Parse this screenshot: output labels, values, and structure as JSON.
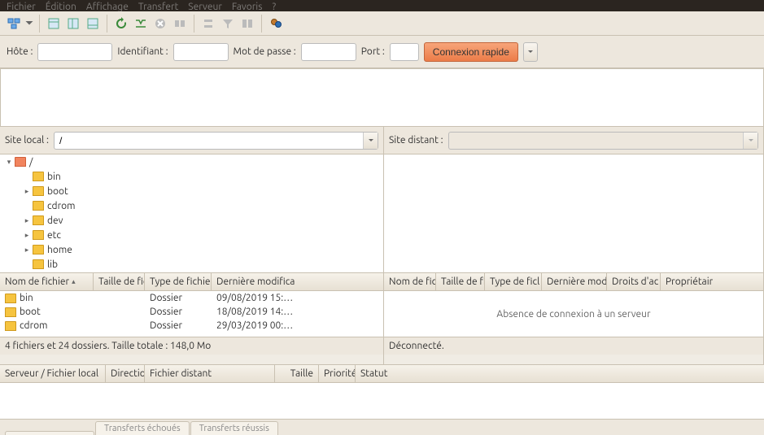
{
  "menubar": [
    "Fichier",
    "Édition",
    "Affichage",
    "Transfert",
    "Serveur",
    "Favoris",
    "?"
  ],
  "quick": {
    "host_label": "Hôte :",
    "user_label": "Identifiant :",
    "pass_label": "Mot de passe :",
    "port_label": "Port :",
    "connect_label": "Connexion rapide"
  },
  "local": {
    "site_label": "Site local :",
    "site_value": "/",
    "tree": [
      {
        "name": "/",
        "depth": 0,
        "expander": "▾",
        "selected": true
      },
      {
        "name": "bin",
        "depth": 1,
        "expander": ""
      },
      {
        "name": "boot",
        "depth": 1,
        "expander": "▸"
      },
      {
        "name": "cdrom",
        "depth": 1,
        "expander": ""
      },
      {
        "name": "dev",
        "depth": 1,
        "expander": "▸"
      },
      {
        "name": "etc",
        "depth": 1,
        "expander": "▸"
      },
      {
        "name": "home",
        "depth": 1,
        "expander": "▸"
      },
      {
        "name": "lib",
        "depth": 1,
        "expander": ""
      }
    ],
    "columns": {
      "name": "Nom de fichier",
      "size": "Taille de fic",
      "type": "Type de fichier",
      "modified": "Dernière modifica"
    },
    "rows": [
      {
        "name": "bin",
        "size": "",
        "type": "Dossier",
        "modified": "09/08/2019 15:…"
      },
      {
        "name": "boot",
        "size": "",
        "type": "Dossier",
        "modified": "18/08/2019 14:…"
      },
      {
        "name": "cdrom",
        "size": "",
        "type": "Dossier",
        "modified": "29/03/2019 00:…"
      }
    ],
    "status": "4 fichiers et 24 dossiers. Taille totale : 148,0 Mo"
  },
  "remote": {
    "site_label": "Site distant :",
    "columns": {
      "name": "Nom de fic",
      "size": "Taille de fi",
      "type": "Type de ficl",
      "modified": "Dernière modi",
      "perms": "Droits d'ac",
      "owner": "Propriétair"
    },
    "empty_msg": "Absence de connexion à un serveur",
    "status": "Déconnecté."
  },
  "queue": {
    "columns": {
      "server": "Serveur / Fichier local",
      "direction": "Directio",
      "remotefile": "Fichier distant",
      "size": "Taille",
      "priority": "Priorité",
      "status": "Statut"
    }
  },
  "tabs": [
    "",
    "Transferts échoués",
    "Transferts réussis"
  ]
}
